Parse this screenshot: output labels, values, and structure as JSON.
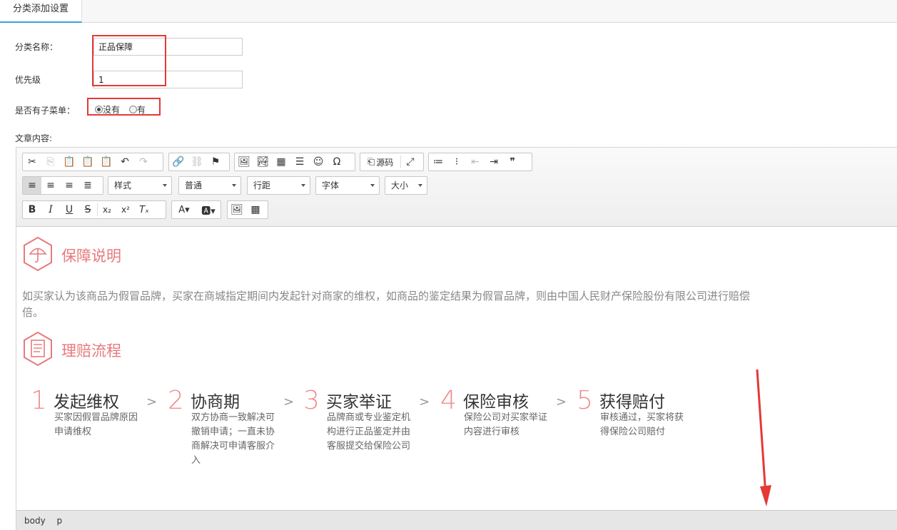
{
  "tab": {
    "label": "分类添加设置"
  },
  "form": {
    "name_label": "分类名称：",
    "name_value": "正品保障",
    "priority_label": "优先级",
    "priority_value": "1",
    "submenu_label": "是否有子菜单：",
    "submenu_options": [
      "没有",
      "有"
    ],
    "submenu_selected": "没有",
    "content_label": "文章内容:"
  },
  "toolbar": {
    "row1": [
      "cut-icon",
      "copy-icon",
      "paste-icon",
      "paste-text-icon",
      "paste-word-icon",
      "undo-icon",
      "redo-icon",
      "link-icon",
      "unlink-icon",
      "anchor-icon",
      "image-icon",
      "flash-icon",
      "table-icon",
      "hr-icon",
      "emoji-icon",
      "special-char-icon",
      "source-icon",
      "fullscreen-icon",
      "ordered-list-icon",
      "unordered-list-icon",
      "outdent-icon",
      "indent-icon",
      "quote-icon"
    ],
    "source_label": "源码",
    "dropdowns": {
      "style": "样式",
      "format": "普通",
      "line_height": "行距",
      "font": "字体",
      "size": "大小"
    }
  },
  "content": {
    "section1_title": "保障说明",
    "paragraph_line1": "如买家认为该商品为假冒品牌，买家在商城指定期间内发起针对商家的维权，如商品的鉴定结果为假冒品牌，则由中国人民财产保险股份有限公司进行赔偿",
    "paragraph_line2": "倍。",
    "section2_title": "理赔流程",
    "steps": [
      {
        "num": "1",
        "title": "发起维权",
        "desc": "买家因假冒品牌原因申请维权"
      },
      {
        "num": "2",
        "title": "协商期",
        "desc": "双方协商一致解决可撤销申请；一直未协商解决可申请客服介入"
      },
      {
        "num": "3",
        "title": "买家举证",
        "desc": "品牌商或专业鉴定机构进行正品鉴定并由客服提交给保险公司"
      },
      {
        "num": "4",
        "title": "保险审核",
        "desc": "保险公司对买家举证内容进行审核"
      },
      {
        "num": "5",
        "title": "获得赔付",
        "desc": "审核通过，买家将获得保险公司赔付"
      }
    ],
    "chevron": ">"
  },
  "statusbar": {
    "path": [
      "body",
      "p"
    ]
  },
  "colors": {
    "accent_blue": "#38a2d8",
    "title_pink": "#e8797c",
    "annotation_red": "#e53935"
  }
}
